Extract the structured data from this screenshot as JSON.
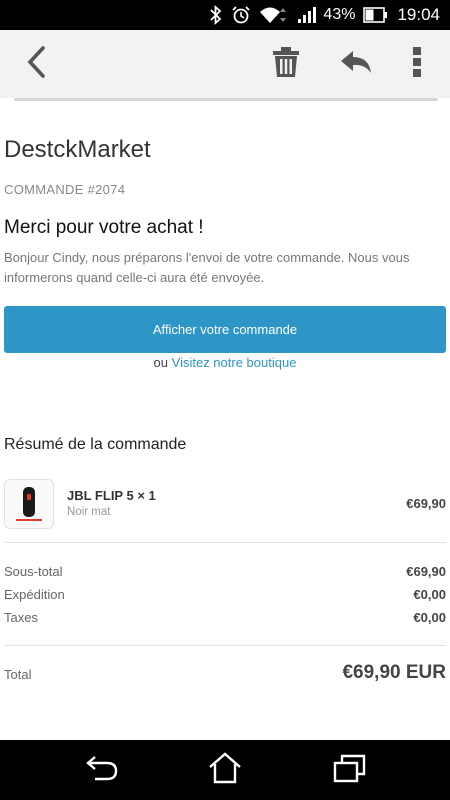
{
  "status_bar": {
    "battery_percent": "43%",
    "time": "19:04",
    "icons": [
      "bluetooth-icon",
      "alarm-icon",
      "wifi-icon",
      "signal-icon",
      "battery-icon"
    ]
  },
  "toolbar": {
    "icons": [
      "back-arrow-icon",
      "trash-icon",
      "reply-icon",
      "more-vert-icon"
    ]
  },
  "email": {
    "shop_name": "DestckMarket",
    "order_number": "COMMANDE #2074",
    "thanks_title": "Merci pour votre achat !",
    "intro_text": "Bonjour Cindy, nous préparons l'envoi de votre commande. Nous vous informerons quand celle-ci aura été envoyée.",
    "view_order_button": "Afficher votre commande",
    "or_text": "ou",
    "visit_store_link": "Visitez notre boutique",
    "summary_title": "Résumé de la commande",
    "product": {
      "name": "JBL FLIP 5 × 1",
      "variant": "Noir mat",
      "price": "€69,90"
    },
    "subtotal_label": "Sous-total",
    "subtotal_value": "€69,90",
    "shipping_label": "Expédition",
    "shipping_value": "€0,00",
    "taxes_label": "Taxes",
    "taxes_value": "€0,00",
    "total_label": "Total",
    "total_value": "€69,90 EUR"
  },
  "nav_bar": {
    "icons": [
      "nav-back-icon",
      "nav-home-icon",
      "nav-recent-apps-icon"
    ]
  },
  "colors": {
    "accent": "#2e96c7",
    "toolbar_bg": "#f2f2f2",
    "status_bar_bg": "#000000"
  }
}
